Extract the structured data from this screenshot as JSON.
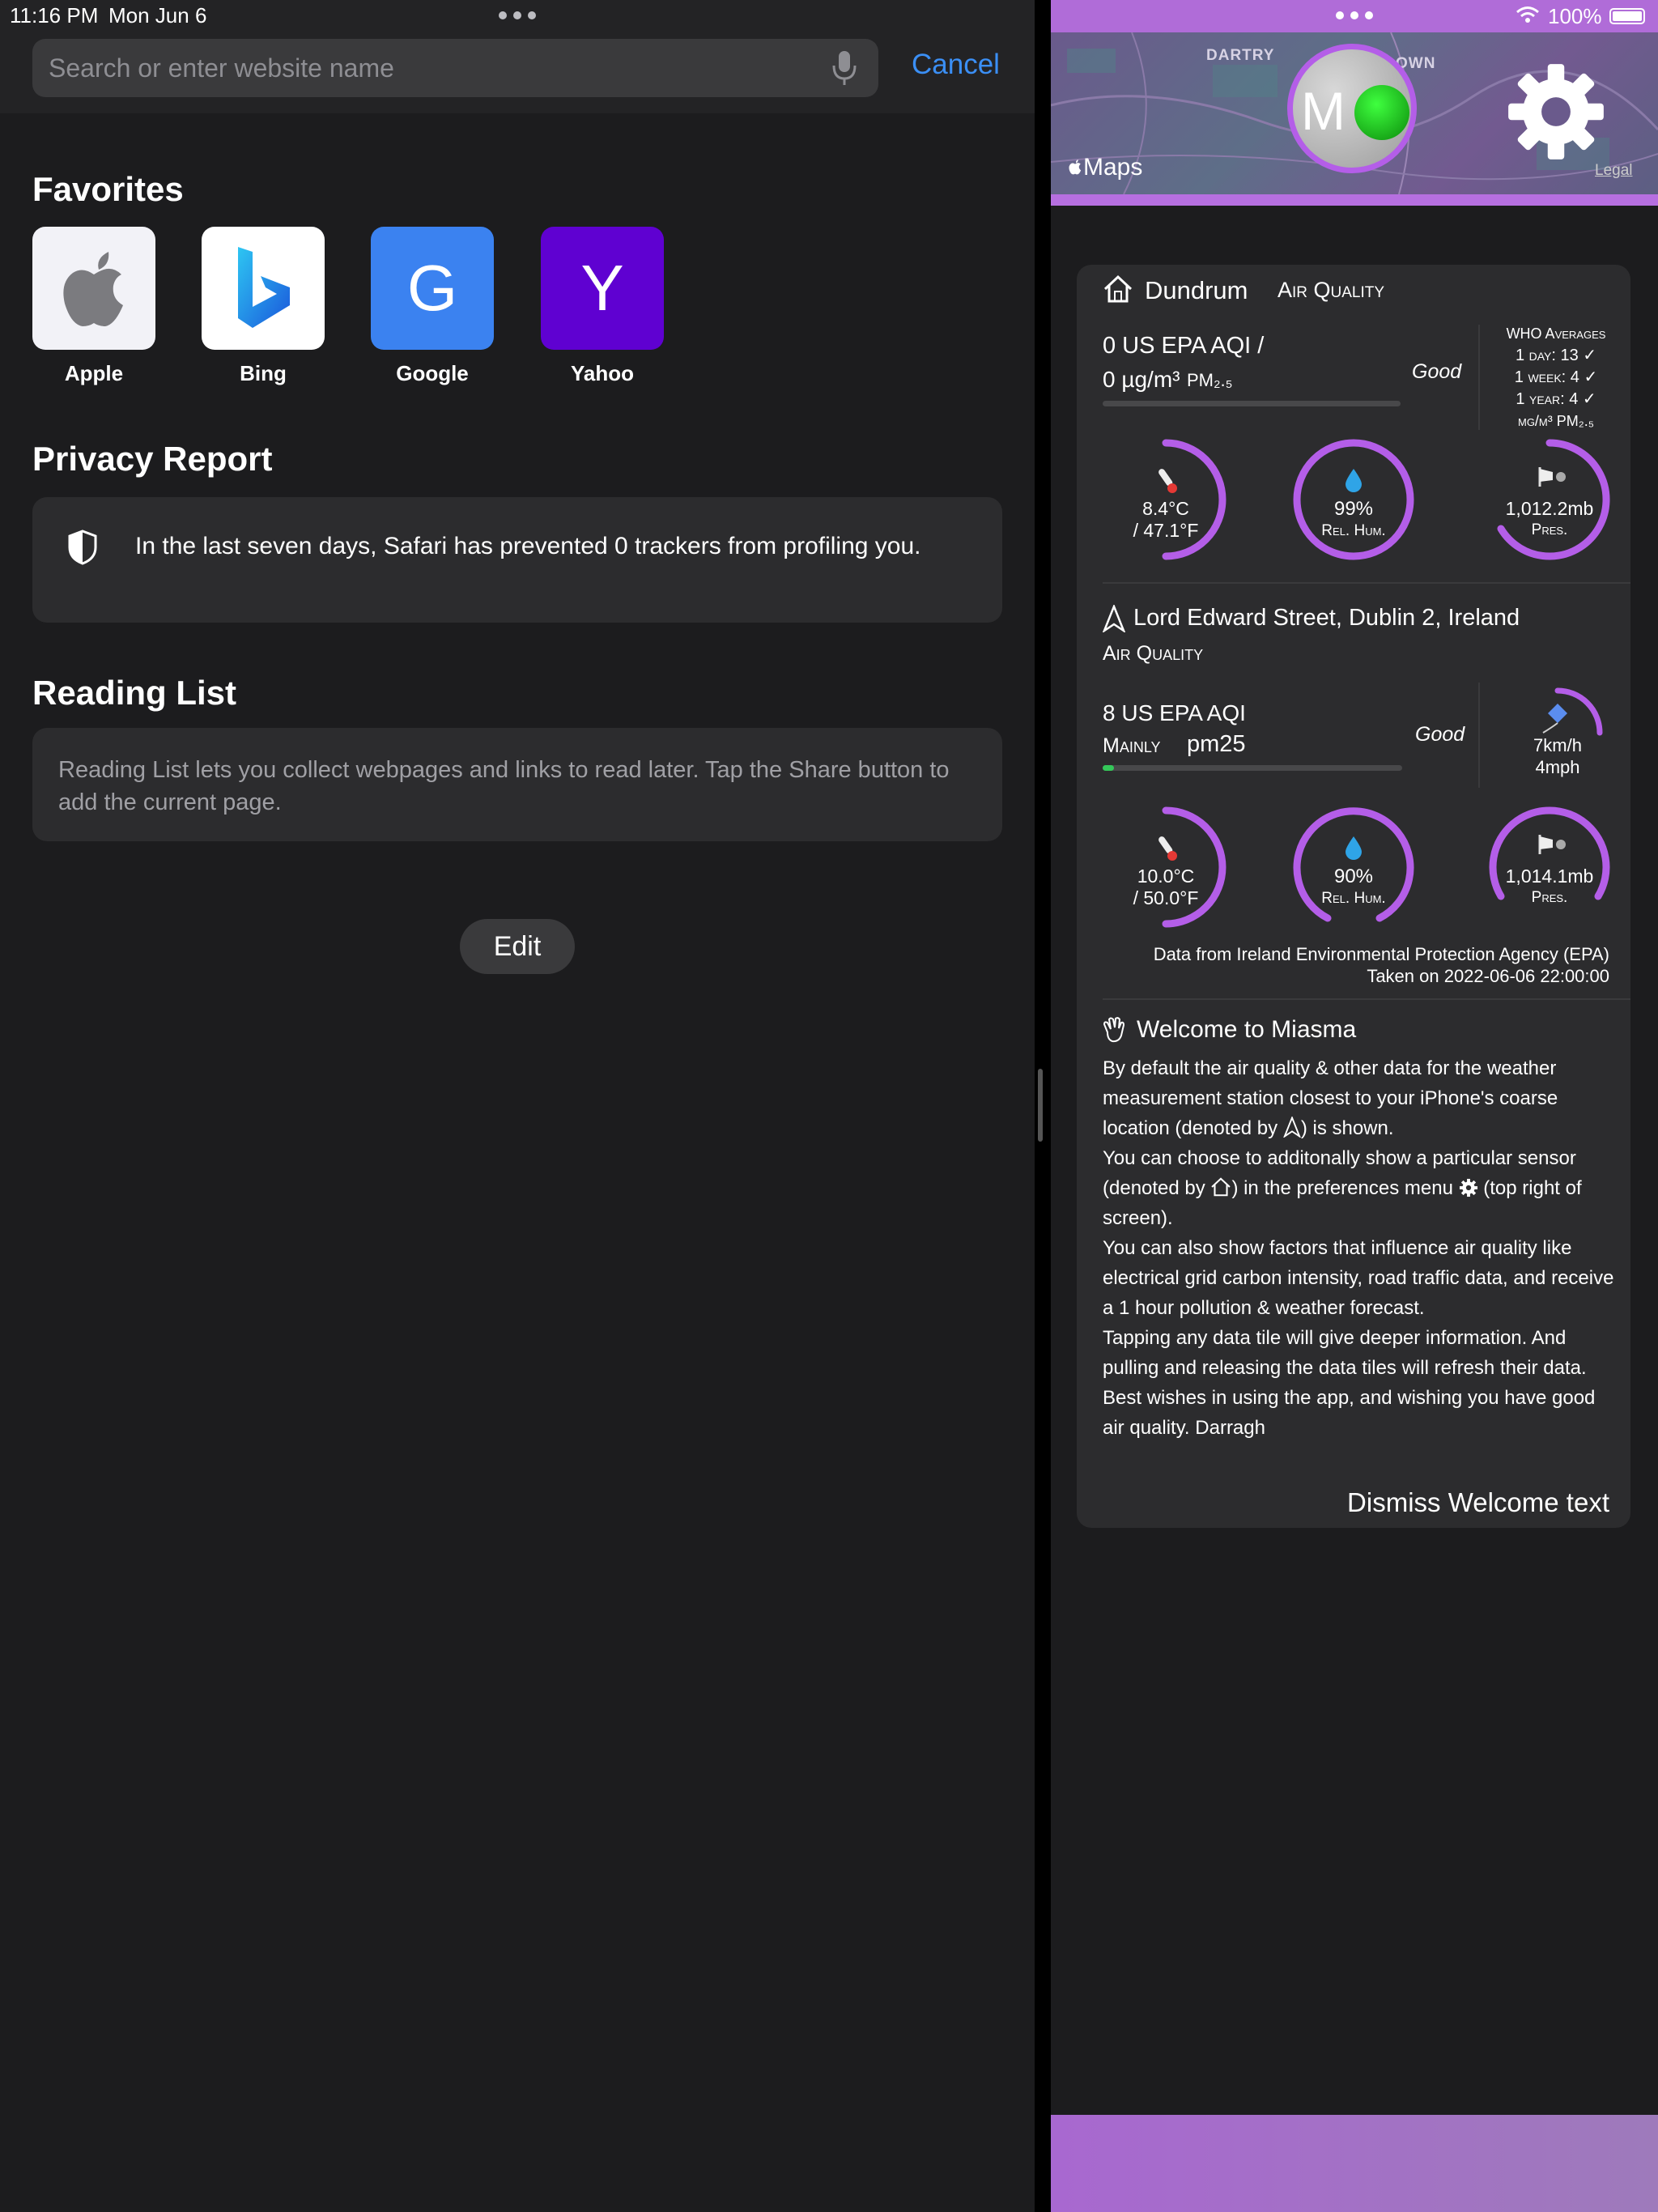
{
  "status": {
    "time": "11:16 PM",
    "date": "Mon Jun 6",
    "battery": "100%"
  },
  "safari": {
    "search": {
      "placeholder": "Search or enter website name"
    },
    "cancel_label": "Cancel",
    "favorites": {
      "heading": "Favorites",
      "items": [
        {
          "label": "Apple",
          "glyph": "",
          "bg": "#f2f2f7",
          "icon": "apple-logo-icon"
        },
        {
          "label": "Bing",
          "glyph": "",
          "bg": "#ffffff",
          "icon": "bing-logo-icon"
        },
        {
          "label": "Google",
          "glyph": "G",
          "bg": "#3b82f0"
        },
        {
          "label": "Yahoo",
          "glyph": "Y",
          "bg": "#5f01d1"
        }
      ]
    },
    "privacy": {
      "heading": "Privacy Report",
      "text": "In the last seven days, Safari has prevented 0 trackers from profiling you."
    },
    "reading": {
      "heading": "Reading List",
      "text": "Reading List lets you collect webpages and links to read later. Tap the Share button to add the current page."
    },
    "edit_label": "Edit"
  },
  "miasma": {
    "map": {
      "labels": [
        "DARTRY",
        "OWN"
      ],
      "maps_label": "Maps",
      "legal": "Legal",
      "avatar_letter": "M"
    },
    "station1": {
      "name": "Dundrum",
      "suffix": "Air Quality",
      "aqi_line": "0 US EPA AQI  /",
      "pm_line_value": "0 µg/m³",
      "pm_line_unit": "PM₂.₅",
      "rating": "Good",
      "who_title": "WHO Averages",
      "who_day": "1 day: 13 ✓",
      "who_week": "1 week: 4 ✓",
      "who_year": "1 year: 4 ✓",
      "who_unit": "µg/m³ PM₂.₅",
      "temp_c": "8.4°C",
      "temp_f": "/ 47.1°F",
      "humidity": "99%",
      "humidity_label": "Rel. Hum.",
      "pressure": "1,012.2mb",
      "pressure_label": "Pres."
    },
    "station2": {
      "name": "Lord Edward Street, Dublin 2, Ireland",
      "suffix": "Air Quality",
      "aqi_line": "8 US EPA AQI",
      "mainly": "Mainly",
      "pollutant": "pm25",
      "rating": "Good",
      "wind_kmh": "7km/h",
      "wind_mph": "4mph",
      "temp_c": "10.0°C",
      "temp_f": "/ 50.0°F",
      "humidity": "90%",
      "humidity_label": "Rel. Hum.",
      "pressure": "1,014.1mb",
      "pressure_label": "Pres.",
      "source": "Data from Ireland Environmental Protection Agency (EPA)",
      "taken": "Taken on 2022-06-06 22:00:00"
    },
    "welcome": {
      "title": "Welcome to Miasma",
      "p1a": "By default the air quality & other data for the weather measurement station closest to your iPhone's coarse location (denoted by ",
      "p1b": ") is shown.",
      "p2a": "You can choose to additonally show a particular sensor (denoted by ",
      "p2b": ") in the preferences menu ",
      "p2c": " (top right of screen).",
      "p3": "You can also show factors that influence air quality like electrical grid carbon intensity, road traffic data, and receive a 1 hour pollution & weather forecast.",
      "p4": "Tapping any data tile will give deeper information. And pulling and releasing the data tiles will refresh their data.",
      "p5": "Best wishes in using the app, and wishing you have good air quality. Darragh",
      "dismiss": "Dismiss Welcome text"
    }
  },
  "colors": {
    "accent_purple": "#b45ee8",
    "link_blue": "#3b8ff5",
    "good_green": "#34c759"
  }
}
